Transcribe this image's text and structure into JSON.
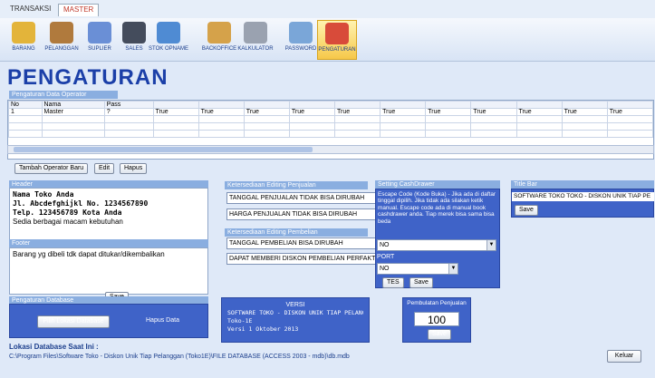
{
  "menu_tabs": [
    "TRANSAKSI",
    "MASTER"
  ],
  "toolbar": [
    {
      "label": "BARANG",
      "icon": "box-icon",
      "color": "#e3b43a"
    },
    {
      "label": "PELANGGAN",
      "icon": "customer-icon",
      "color": "#b07a3d"
    },
    {
      "label": "SUPLIER",
      "icon": "supplier-icon",
      "color": "#6a8fd6"
    },
    {
      "label": "SALES",
      "icon": "sales-person-icon",
      "color": "#444c5c"
    },
    {
      "label": "STOK OPNAME",
      "icon": "stock-opname-icon",
      "color": "#4f8bd3"
    },
    {
      "label": "BACKOFFICE",
      "icon": "backoffice-icon",
      "color": "#d5a24a"
    },
    {
      "label": "KALKULATOR",
      "icon": "calculator-icon",
      "color": "#9aa2b0"
    },
    {
      "label": "PASSWORD",
      "icon": "password-icon",
      "color": "#7aa6d8"
    },
    {
      "label": "PENGATURAN",
      "icon": "settings-house-icon",
      "color": "#d84b3a"
    }
  ],
  "page_title": "PENGATURAN",
  "operator_section": {
    "label": "Pengaturan Data Operator",
    "columns": [
      "No",
      "Nama",
      "Pass",
      "",
      "",
      "",
      "",
      "",
      "",
      "",
      "",
      "",
      "",
      ""
    ],
    "rows": [
      [
        "1",
        "Master",
        "?",
        "True",
        "True",
        "True",
        "True",
        "True",
        "True",
        "True",
        "True",
        "True",
        "True",
        "True"
      ]
    ],
    "buttons": {
      "add": "Tambah Operator Baru",
      "edit": "Edit",
      "delete": "Hapus"
    }
  },
  "header_section": {
    "label": "Header",
    "lines": [
      "Nama Toko Anda",
      "Jl. Abcdefghijkl No. 1234567890",
      "Telp. 123456789 Kota Anda",
      "Sedia berbagai macam kebutuhan"
    ]
  },
  "footer_section": {
    "label": "Footer",
    "text": "Barang yg dibeli tdk dapat ditukar/dikembalikan"
  },
  "save_label": "Save",
  "edit_penjualan": {
    "label": "Ketersediaan Editing Penjualan",
    "options": [
      "TANGGAL PENJUALAN TIDAK BISA DIRUBAH",
      "HARGA PENJUALAN TIDAK BISA DIRUBAH"
    ]
  },
  "edit_pembelian": {
    "label": "Ketersediaan Editing Pembelian",
    "options": [
      "TANGGAL PEMBELIAN BISA DIRUBAH",
      "DAPAT MEMBERI DISKON PEMBELIAN PERFAKTUR"
    ]
  },
  "cash_drawer": {
    "label": "Setting CashDrawer",
    "description": "Escape Code (Kode Buka) - Jika ada di daftar tinggal dipilih. Jika tidak ada silakan ketik manual. Escape code ada di manual book cashdrawer anda. Tiap merek bisa sama bisa beda",
    "escape_value": "NO",
    "port_label": "PORT",
    "port_value": "NO",
    "test_label": "TES",
    "save_label": "Save"
  },
  "title_bar": {
    "label": "Title Bar",
    "value": "SOFTWARE TOKO TOKO - DISKON UNIK TIAP PE",
    "save_label": "Save"
  },
  "version": {
    "label": "VERSI",
    "lines": [
      "SOFTWARE TOKO - DISKON UNIK TIAP PELANGGAN",
      "Toko-1E",
      "Versi 1 Oktober 2013"
    ]
  },
  "rounding": {
    "label": "Pembulatan Penjualan",
    "value": "100",
    "save_label": "Save"
  },
  "database": {
    "label": "Pengaturan Database",
    "choose": "Pilih Lokasi Database",
    "delete": "Hapus Data"
  },
  "db_location": {
    "title": "Lokasi Database Saat Ini :",
    "path": "C:\\Program Files\\Software Toko - Diskon Unik Tiap Pelanggan (Toko1E)\\FILE DATABASE (ACCESS 2003 - mdb)\\db.mdb"
  },
  "exit_label": "Keluar"
}
